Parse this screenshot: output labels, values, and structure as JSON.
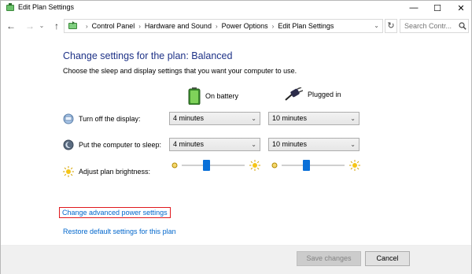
{
  "window": {
    "title": "Edit Plan Settings",
    "minimize": "—",
    "maximize": "☐",
    "close": "✕"
  },
  "nav": {
    "back": "←",
    "forward": "→",
    "history": "⌄",
    "up": "↑",
    "breadcrumbs": [
      "Control Panel",
      "Hardware and Sound",
      "Power Options",
      "Edit Plan Settings"
    ],
    "breadcrumb_sep": "›",
    "refresh": "↻",
    "search_placeholder": "Search Contr..."
  },
  "main": {
    "heading": "Change settings for the plan: Balanced",
    "subtitle": "Choose the sleep and display settings that you want your computer to use.",
    "columns": {
      "battery": "On battery",
      "plugged": "Plugged in"
    },
    "rows": {
      "display": {
        "label": "Turn off the display:",
        "battery": "4 minutes",
        "plugged": "10 minutes"
      },
      "sleep": {
        "label": "Put the computer to sleep:",
        "battery": "4 minutes",
        "plugged": "10 minutes"
      },
      "brightness": {
        "label": "Adjust plan brightness:",
        "battery_level": 0.38,
        "plugged_level": 0.38
      }
    },
    "links": {
      "advanced": "Change advanced power settings",
      "restore": "Restore default settings for this plan"
    }
  },
  "footer": {
    "save": "Save changes",
    "cancel": "Cancel",
    "save_enabled": false
  },
  "colors": {
    "heading": "#1e3287",
    "link": "#0066cc",
    "highlight": "#e0191e",
    "slider_thumb": "#0a70d8"
  },
  "icons": [
    "power-plan-icon",
    "battery-icon",
    "plug-icon",
    "display-icon",
    "sleep-icon",
    "brightness-low-icon",
    "brightness-high-icon",
    "search-icon"
  ]
}
